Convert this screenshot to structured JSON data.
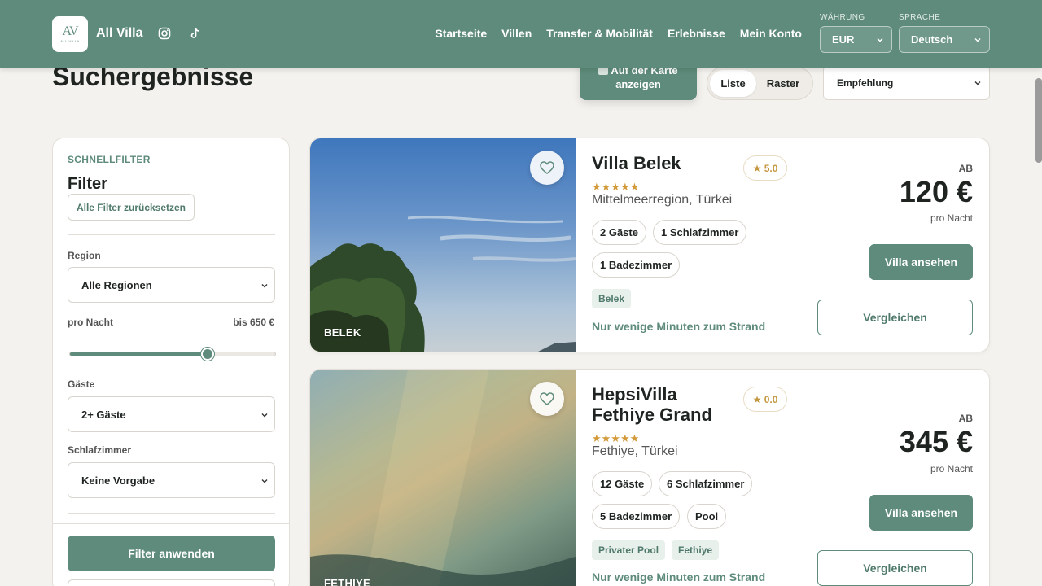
{
  "header": {
    "brand_name": "All Villa",
    "logo_mark": "AV",
    "logo_sub": "ALL VILLA",
    "nav": [
      "Startseite",
      "Villen",
      "Transfer & Mobilität",
      "Erlebnisse",
      "Mein Konto"
    ],
    "currency_label": "WÄHRUNG",
    "currency_value": "EUR",
    "language_label": "SPRACHE",
    "language_value": "Deutsch"
  },
  "results": {
    "title": "Suchergebnisse",
    "map_button": "Auf der Karte anzeigen",
    "view_list": "Liste",
    "view_grid": "Raster",
    "sort_value": "Empfehlung"
  },
  "filters": {
    "eyebrow": "SCHNELLFILTER",
    "title": "Filter",
    "reset": "Alle Filter zurücksetzen",
    "region_label": "Region",
    "region_value": "Alle Regionen",
    "price_label": "pro Nacht",
    "price_max": "bis 650 €",
    "price_slider_fraction": 0.67,
    "guests_label": "Gäste",
    "guests_value": "2+ Gäste",
    "bedrooms_label": "Schlafzimmer",
    "bedrooms_value": "Keine Vorgabe",
    "apply": "Filter anwenden"
  },
  "listings": [
    {
      "image_tag": "BELEK",
      "name": "Villa Belek",
      "rating": "★ 5.0",
      "stars": "★★★★★",
      "location": "Mittelmeerregion, Türkei",
      "chips": [
        "2 Gäste",
        "1 Schlafzimmer",
        "1 Badezimmer"
      ],
      "tags": [
        "Belek"
      ],
      "highlight": "Nur wenige Minuten zum Strand",
      "price_prefix": "AB",
      "price": "120 €",
      "price_unit": "pro Nacht",
      "view_button": "Villa ansehen",
      "compare_button": "Vergleichen"
    },
    {
      "image_tag": "FETHIYE",
      "name": "HepsiVilla Fethiye Grand",
      "rating": "★ 0.0",
      "stars": "★★★★★",
      "location": "Fethiye, Türkei",
      "chips": [
        "12 Gäste",
        "6 Schlafzimmer",
        "5 Badezimmer",
        "Pool"
      ],
      "tags": [
        "Privater Pool",
        "Fethiye"
      ],
      "highlight": "Nur wenige Minuten zum Strand",
      "price_prefix": "AB",
      "price": "345 €",
      "price_unit": "pro Nacht",
      "view_button": "Villa ansehen",
      "compare_button": "Vergleichen"
    }
  ],
  "colors": {
    "brand": "#5e8b7b",
    "background": "#f4f2ee",
    "star": "#d39a3a"
  }
}
